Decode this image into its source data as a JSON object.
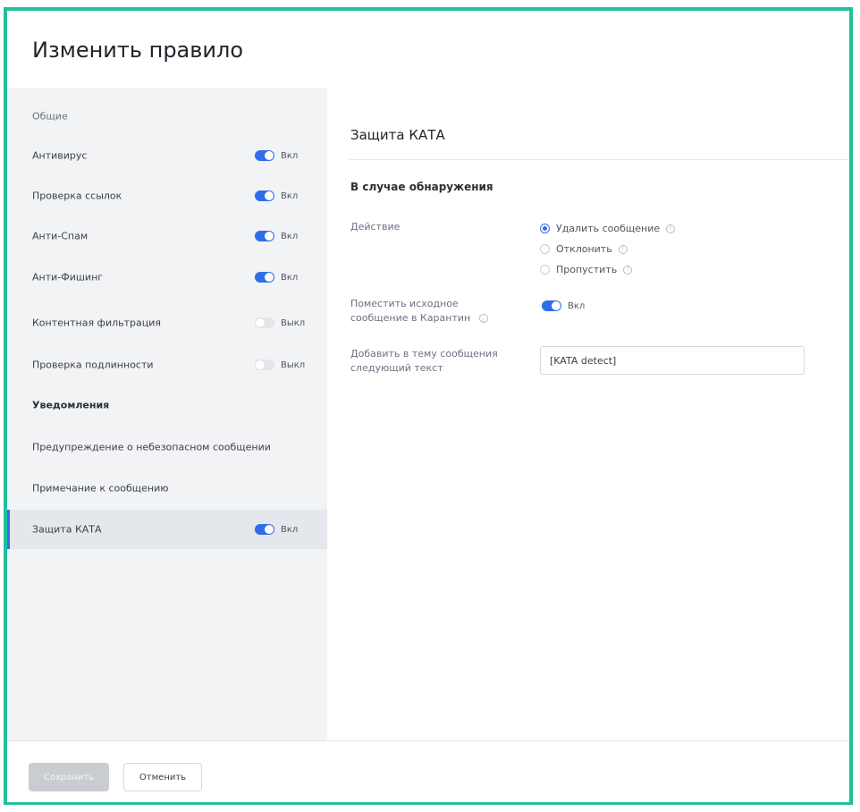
{
  "dialog": {
    "title": "Изменить правило"
  },
  "sidebar": {
    "items": [
      {
        "label": "Общие",
        "type": "section"
      },
      {
        "label": "Антивирус",
        "toggle": {
          "state": "on",
          "text": "Вкл"
        }
      },
      {
        "label": "Проверка ссылок",
        "toggle": {
          "state": "on",
          "text": "Вкл"
        }
      },
      {
        "label": "Анти-Спам",
        "toggle": {
          "state": "on",
          "text": "Вкл"
        }
      },
      {
        "label": "Анти-Фишинг",
        "toggle": {
          "state": "on",
          "text": "Вкл"
        }
      },
      {
        "label": "Контентная фильтрация",
        "toggle": {
          "state": "off",
          "text": "Выкл"
        }
      },
      {
        "label": "Проверка подлинности",
        "toggle": {
          "state": "off",
          "text": "Выкл"
        }
      },
      {
        "label": "Уведомления",
        "type": "bold"
      },
      {
        "label": "Предупреждение о небезопасном сообщении"
      },
      {
        "label": "Примечание к сообщению"
      },
      {
        "label": "Защита КАТА",
        "active": true,
        "toggle": {
          "state": "on",
          "text": "Вкл"
        }
      }
    ]
  },
  "main": {
    "title": "Защита КАТА",
    "subtitle": "В случае обнаружения",
    "action": {
      "label": "Действие",
      "options": [
        {
          "label": "Удалить сообщение",
          "checked": true
        },
        {
          "label": "Отклонить",
          "checked": false
        },
        {
          "label": "Пропустить",
          "checked": false
        }
      ]
    },
    "quarantine": {
      "label_line1": "Поместить исходное",
      "label_line2": "сообщение в Карантин",
      "toggle": {
        "state": "on",
        "text": "Вкл"
      }
    },
    "subject": {
      "label_line1": "Добавить в тему сообщения",
      "label_line2": "следующий текст",
      "value": "[KATA detect]"
    }
  },
  "footer": {
    "save_label": "Сохранить",
    "cancel_label": "Отменить"
  },
  "colors": {
    "accent": "#2f6ee8",
    "frame": "#1fc19a"
  }
}
